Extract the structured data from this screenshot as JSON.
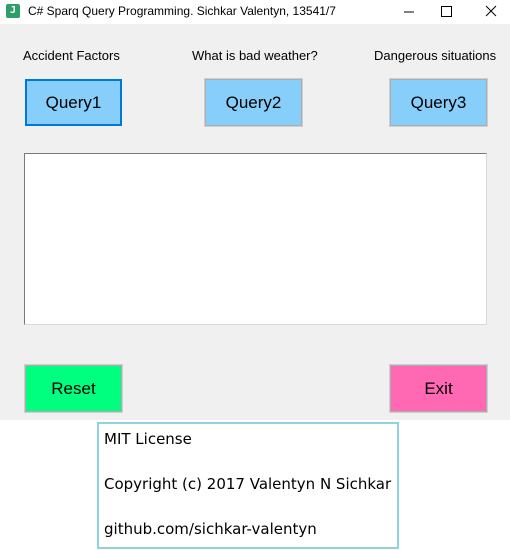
{
  "window": {
    "title": "C# Sparq Query Programming. Sichkar Valentyn, 13541/7",
    "icon": "app-icon",
    "icon_glyph": "J",
    "controls": [
      "minimize-icon",
      "maximize-icon",
      "close-icon"
    ]
  },
  "labels": {
    "query1": "Accident Factors",
    "query2": "What is bad weather?",
    "query3": "Dangerous situations"
  },
  "buttons": {
    "query1": "Query1",
    "query2": "Query2",
    "query3": "Query3",
    "reset": "Reset",
    "exit": "Exit"
  },
  "output": {
    "text": ""
  },
  "license": {
    "line1": "MIT License",
    "line2": "Copyright (c) 2017 Valentyn N Sichkar",
    "line3": "github.com/sichkar-valentyn"
  },
  "colors": {
    "query_button": "#87cefa",
    "reset_button": "#00ff7f",
    "exit_button": "#ff69b4",
    "focus_border": "#0078d7",
    "license_border": "#8fd3e0"
  }
}
